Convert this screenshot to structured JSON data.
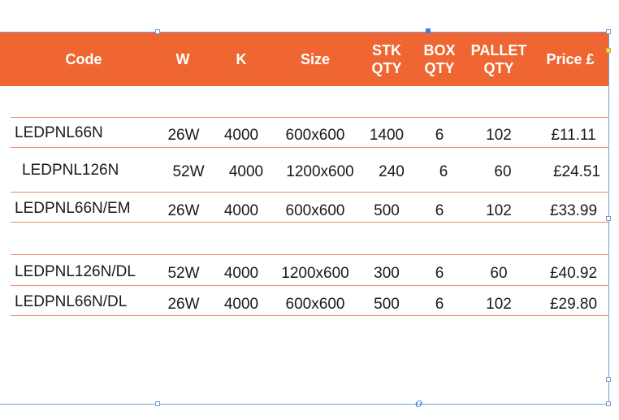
{
  "header": {
    "code": "Code",
    "w": "W",
    "k": "K",
    "size": "Size",
    "stk_qty": "STK\nQTY",
    "box_qty": "BOX\nQTY",
    "pallet_qty": "PALLET\nQTY",
    "price": "Price £"
  },
  "rows": [
    {
      "code": "LEDPNL66N",
      "w": "26W",
      "k": "4000",
      "size": "600x600",
      "stk": "1400",
      "box": "6",
      "pallet": "102",
      "price": "£11.11"
    },
    {
      "code": "LEDPNL126N",
      "w": "52W",
      "k": "4000",
      "size": "1200x600",
      "stk": "240",
      "box": "6",
      "pallet": "60",
      "price": "£24.51"
    },
    {
      "code": "LEDPNL66N/EM",
      "w": "26W",
      "k": "4000",
      "size": "600x600",
      "stk": "500",
      "box": "6",
      "pallet": "102",
      "price": "£33.99"
    },
    {
      "code": "LEDPNL126N/DL",
      "w": "52W",
      "k": "4000",
      "size": "1200x600",
      "stk": "300",
      "box": "6",
      "pallet": "60",
      "price": "£40.92"
    },
    {
      "code": "LEDPNL66N/DL",
      "w": "26W",
      "k": "4000",
      "size": "600x600",
      "stk": "500",
      "box": "6",
      "pallet": "102",
      "price": "£29.80"
    }
  ],
  "colors": {
    "header_bg": "#ef6632",
    "header_text": "#ffffff",
    "row_rule": "#ef8a6a",
    "selection": "#6f9fd8"
  },
  "selection_frame": {
    "origin_marker": "o"
  }
}
